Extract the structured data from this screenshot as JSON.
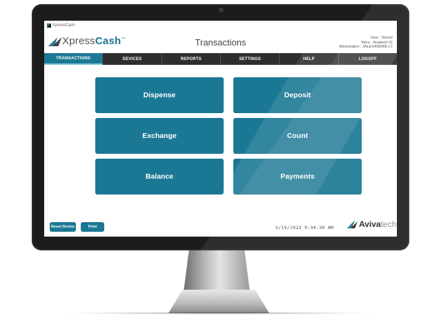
{
  "mini_brand": "XpressCash",
  "logo": {
    "main": "Xpress",
    "accent": "Cash",
    "tm": "™"
  },
  "page_title": "Transactions",
  "user": {
    "user_line": "User : Store2",
    "store_line": "Store : Aviatech 01",
    "workstation_line": "Workstation : JALEXANDRE-LT"
  },
  "nav": {
    "items": [
      {
        "label": "TRANSACTIONS",
        "active": true
      },
      {
        "label": "DEVICES"
      },
      {
        "label": "REPORTS"
      },
      {
        "label": "SETTINGS"
      },
      {
        "label": "HELP"
      },
      {
        "label": "LOGOFF"
      }
    ]
  },
  "tiles": [
    {
      "label": "Dispense"
    },
    {
      "label": "Deposit"
    },
    {
      "label": "Exchange"
    },
    {
      "label": "Count"
    },
    {
      "label": "Balance"
    },
    {
      "label": "Payments"
    }
  ],
  "footer": {
    "reset_label": "Reset Device",
    "print_label": "Print",
    "datetime": "5/19/2022 9:34:30 AM",
    "brand_main": "Aviva",
    "brand_tech": "tech",
    "brand_tm": "™"
  },
  "colors": {
    "accent": "#1b7894",
    "nav_bg": "#2e2e2e",
    "bezel": "#1c1c1c"
  }
}
